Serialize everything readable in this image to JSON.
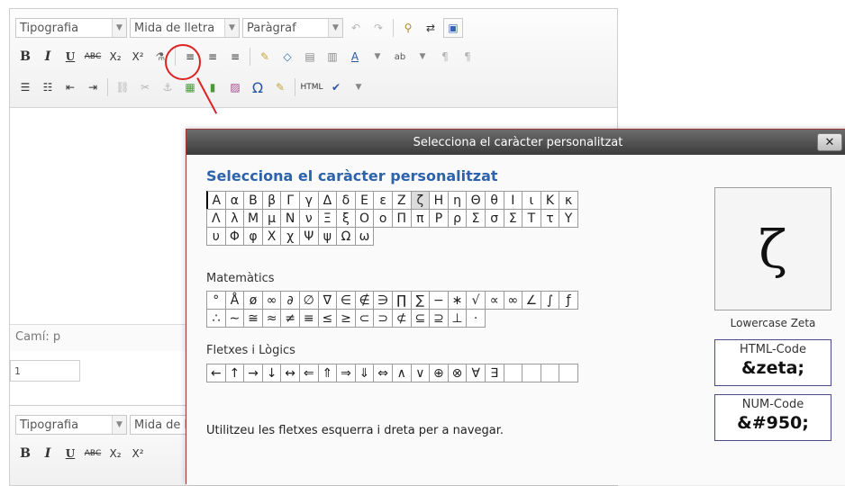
{
  "editor": {
    "toolbar": {
      "font_select": "Tipografia",
      "size_select": "Mida de lletra",
      "format_select": "Paràgraf",
      "bold": "B",
      "italic": "I",
      "underline": "U",
      "strike": "ABC",
      "sub": "X₂",
      "sup": "X²",
      "html_btn": "HTML"
    },
    "path_label": "Camí: p",
    "field_value": "1"
  },
  "editor2": {
    "font_select": "Tipografia",
    "size_select": "Mida de ll"
  },
  "dialog": {
    "title": "Selecciona el caràcter personalitzat",
    "close_label": "✕",
    "heading": "Selecciona el caràcter personalitzat",
    "greek_rows": [
      [
        "Α",
        "α",
        "Β",
        "β",
        "Γ",
        "γ",
        "Δ",
        "δ",
        "Ε",
        "ε",
        "Ζ",
        "ζ",
        "Η",
        "η",
        "Θ",
        "θ",
        "Ι",
        "ι",
        "Κ",
        "κ"
      ],
      [
        "Λ",
        "λ",
        "Μ",
        "μ",
        "Ν",
        "ν",
        "Ξ",
        "ξ",
        "Ο",
        "ο",
        "Π",
        "π",
        "Ρ",
        "ρ",
        "Σ",
        "σ",
        "Σ",
        "Τ",
        "τ",
        "Υ"
      ],
      [
        "υ",
        "Φ",
        "φ",
        "Χ",
        "χ",
        "Ψ",
        "ψ",
        "Ω",
        "ω"
      ]
    ],
    "math_label": "Matemàtics",
    "math_rows": [
      [
        "°",
        "Å",
        "ø",
        "∞",
        "∂",
        "∅",
        "∇",
        "∈",
        "∉",
        "∋",
        "∏",
        "∑",
        "−",
        "∗",
        "√",
        "∝",
        "∞",
        "∠",
        "∫",
        "ƒ"
      ],
      [
        "∴",
        "∼",
        "≅",
        "≈",
        "≠",
        "≡",
        "≤",
        "≥",
        "⊂",
        "⊃",
        "⊄",
        "⊆",
        "⊇",
        "⊥",
        "⋅"
      ]
    ],
    "arrows_label": "Fletxes i Lògics",
    "arrow_rows": [
      [
        "←",
        "↑",
        "→",
        "↓",
        "↔",
        "⇐",
        "⇑",
        "⇒",
        "⇓",
        "⇔",
        "∧",
        "∨",
        "⊕",
        "⊗",
        "∀",
        "∃",
        "",
        "",
        "",
        ""
      ]
    ],
    "preview_char": "ζ",
    "preview_name": "Lowercase Zeta",
    "html_code_label": "HTML-Code",
    "html_code_value": "&zeta;",
    "num_code_label": "NUM-Code",
    "num_code_value": "&#950;",
    "help": "Utilitzeu les fletxes esquerra i dreta per a navegar."
  },
  "colors": {
    "accent": "#2d63ad",
    "highlight_circle": "#dd2222",
    "dialog_border": "#9b3b3b"
  }
}
